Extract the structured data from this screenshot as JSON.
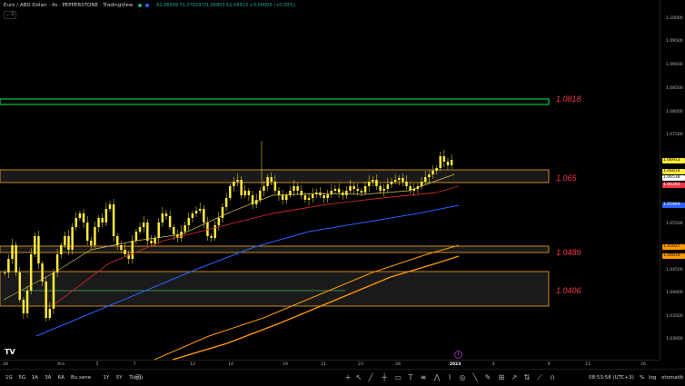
{
  "header": {
    "symbol_title": "Euro / ABD Doları · 4s · PEPPERSTONE · TradingView",
    "ohlc": "A1.06909 Y1.07029 D1.06803 K1.06913 +0.00003 (+0.00%)",
    "collapse_label": "⌄ 2"
  },
  "colors": {
    "zone_green": "#00c853",
    "zone_orange": "#f5a623",
    "label_red": "#f23645",
    "candle": "#ffeb3b",
    "ma_yellow": "#d4c44f",
    "ma_red": "#c62828",
    "ma_blue": "#2962ff",
    "ma_orange": "#ff9800"
  },
  "zones": [
    {
      "level_label": "1.0818",
      "color": "green"
    },
    {
      "level_label": "1.065",
      "color": "orange"
    },
    {
      "level_label": "1.0489",
      "color": "orange"
    },
    {
      "level_label": "1.0406",
      "color": "orange"
    }
  ],
  "price_axis": {
    "labels": [
      "1.10000",
      "1.09500",
      "1.09000",
      "1.08500",
      "1.08000",
      "1.07500",
      "1.05500",
      "1.05000",
      "1.04500",
      "1.04000",
      "1.03500",
      "1.03000"
    ],
    "tags": [
      {
        "text": "1.06913",
        "bg": "#ffeb3b"
      },
      {
        "text": "1.06814",
        "bg": "#ffeb3b"
      },
      {
        "text": "1.06538",
        "bg": "#ffffff"
      },
      {
        "text": "1.06392",
        "bg": "#f23645"
      },
      {
        "text": "1.05969",
        "bg": "#2962ff"
      },
      {
        "text": "1.05037",
        "bg": "#ff9800"
      },
      {
        "text": "1.04819",
        "bg": "#ff9800"
      }
    ]
  },
  "time_axis": [
    "28",
    "Ara",
    "5",
    "7",
    "12",
    "14",
    "19",
    "21",
    "23",
    "28",
    "2023",
    "4",
    "9",
    "11",
    "16"
  ],
  "bottom_bar": {
    "timeframes": [
      "1G",
      "5G",
      "1A",
      "3A",
      "6A",
      "Bu sene",
      "1Y",
      "5Y",
      "Tümü"
    ],
    "clock": "08:53:58 (UTC+3)",
    "percent": "%",
    "log": "log",
    "auto": "otomatik"
  },
  "logo": "TV"
}
